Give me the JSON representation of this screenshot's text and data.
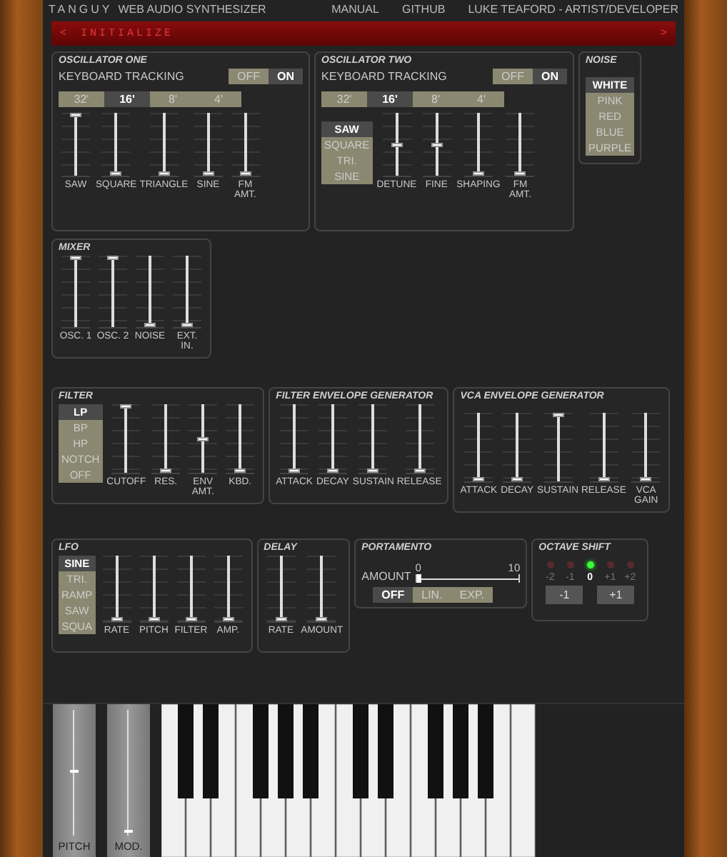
{
  "header": {
    "brand": "TANGUY",
    "title": "WEB AUDIO SYNTHESIZER",
    "links": [
      "MANUAL",
      "GITHUB",
      "LUKE TEAFORD - ARTIST/DEVELOPER"
    ]
  },
  "preset_bar": {
    "prev": "<",
    "name": "INITIALIZE",
    "next": ">"
  },
  "oscillator_one": {
    "title": "OSCILLATOR ONE",
    "tracking_label": "KEYBOARD TRACKING",
    "tracking": [
      {
        "label": "OFF",
        "selected": false
      },
      {
        "label": "ON",
        "selected": true
      }
    ],
    "ranges": [
      {
        "label": "32'",
        "selected": false
      },
      {
        "label": "16'",
        "selected": true
      },
      {
        "label": "8'",
        "selected": false
      },
      {
        "label": "4'",
        "selected": false
      }
    ],
    "sliders": [
      {
        "label": "SAW",
        "level": 1
      },
      {
        "label": "SQUARE",
        "level": 0
      },
      {
        "label": "TRIANGLE",
        "level": 0
      },
      {
        "label": "SINE",
        "level": 0
      },
      {
        "label": "FM AMT.",
        "level": 0
      }
    ]
  },
  "oscillator_two": {
    "title": "OSCILLATOR TWO",
    "tracking_label": "KEYBOARD TRACKING",
    "tracking": [
      {
        "label": "OFF",
        "selected": false
      },
      {
        "label": "ON",
        "selected": true
      }
    ],
    "ranges": [
      {
        "label": "32'",
        "selected": false
      },
      {
        "label": "16'",
        "selected": true
      },
      {
        "label": "8'",
        "selected": false
      },
      {
        "label": "4'",
        "selected": false
      }
    ],
    "waveforms": [
      {
        "label": "SAW",
        "selected": true
      },
      {
        "label": "SQUARE",
        "selected": false
      },
      {
        "label": "TRI.",
        "selected": false
      },
      {
        "label": "SINE",
        "selected": false
      }
    ],
    "sliders": [
      {
        "label": "DETUNE",
        "level": 0.5
      },
      {
        "label": "FINE",
        "level": 0.5
      },
      {
        "label": "SHAPING",
        "level": 0
      },
      {
        "label": "FM AMT.",
        "level": 0
      }
    ]
  },
  "noise": {
    "title": "NOISE",
    "colors": [
      {
        "label": "WHITE",
        "selected": true
      },
      {
        "label": "PINK",
        "selected": false
      },
      {
        "label": "RED",
        "selected": false
      },
      {
        "label": "BLUE",
        "selected": false
      },
      {
        "label": "PURPLE",
        "selected": false
      }
    ]
  },
  "mixer": {
    "title": "MIXER",
    "sliders": [
      {
        "label": "OSC. 1",
        "level": 1
      },
      {
        "label": "OSC. 2",
        "level": 1
      },
      {
        "label": "NOISE",
        "level": 0
      },
      {
        "label": "EXT. IN.",
        "level": 0
      }
    ]
  },
  "filter": {
    "title": "FILTER",
    "modes": [
      {
        "label": "LP",
        "selected": true
      },
      {
        "label": "BP",
        "selected": false
      },
      {
        "label": "HP",
        "selected": false
      },
      {
        "label": "NOTCH",
        "selected": false
      },
      {
        "label": "OFF",
        "selected": false
      }
    ],
    "sliders": [
      {
        "label": "CUTOFF",
        "level": 1
      },
      {
        "label": "RES.",
        "level": 0
      },
      {
        "label": "ENV AMT.",
        "level": 0.5
      },
      {
        "label": "KBD.",
        "level": 0
      }
    ]
  },
  "filter_envelope": {
    "title": "FILTER ENVELOPE GENERATOR",
    "sliders": [
      {
        "label": "ATTACK",
        "level": 0
      },
      {
        "label": "DECAY",
        "level": 0
      },
      {
        "label": "SUSTAIN",
        "level": 0
      },
      {
        "label": "RELEASE",
        "level": 0
      }
    ]
  },
  "vca_envelope": {
    "title": "VCA ENVELOPE GENERATOR",
    "sliders": [
      {
        "label": "ATTACK",
        "level": 0
      },
      {
        "label": "DECAY",
        "level": 0
      },
      {
        "label": "SUSTAIN",
        "level": 1
      },
      {
        "label": "RELEASE",
        "level": 0
      },
      {
        "label": "VCA GAIN",
        "level": 0
      }
    ]
  },
  "lfo": {
    "title": "LFO",
    "waveforms": [
      {
        "label": "SINE",
        "selected": true
      },
      {
        "label": "TRI.",
        "selected": false
      },
      {
        "label": "RAMP",
        "selected": false
      },
      {
        "label": "SAW",
        "selected": false
      },
      {
        "label": "SQUA",
        "selected": false
      }
    ],
    "sliders": [
      {
        "label": "RATE",
        "level": 0
      },
      {
        "label": "PITCH",
        "level": 0
      },
      {
        "label": "FILTER",
        "level": 0
      },
      {
        "label": "AMP.",
        "level": 0
      }
    ]
  },
  "delay": {
    "title": "DELAY",
    "sliders": [
      {
        "label": "RATE",
        "level": 0
      },
      {
        "label": "AMOUNT",
        "level": 0
      }
    ]
  },
  "portamento": {
    "title": "PORTAMENTO",
    "amount_label": "AMOUNT",
    "min": "0",
    "max": "10",
    "level": 0,
    "modes": [
      {
        "label": "OFF",
        "selected": true
      },
      {
        "label": "LIN.",
        "selected": false
      },
      {
        "label": "EXP.",
        "selected": false
      }
    ]
  },
  "octave_shift": {
    "title": "OCTAVE SHIFT",
    "leds": [
      {
        "label": "-2",
        "on": false
      },
      {
        "label": "-1",
        "on": false
      },
      {
        "label": "0",
        "on": true
      },
      {
        "label": "+1",
        "on": false
      },
      {
        "label": "+2",
        "on": false
      }
    ],
    "buttons": [
      "-1",
      "+1"
    ]
  },
  "wheels": [
    {
      "label": "PITCH",
      "level": 0.5
    },
    {
      "label": "MOD.",
      "level": 0
    }
  ]
}
